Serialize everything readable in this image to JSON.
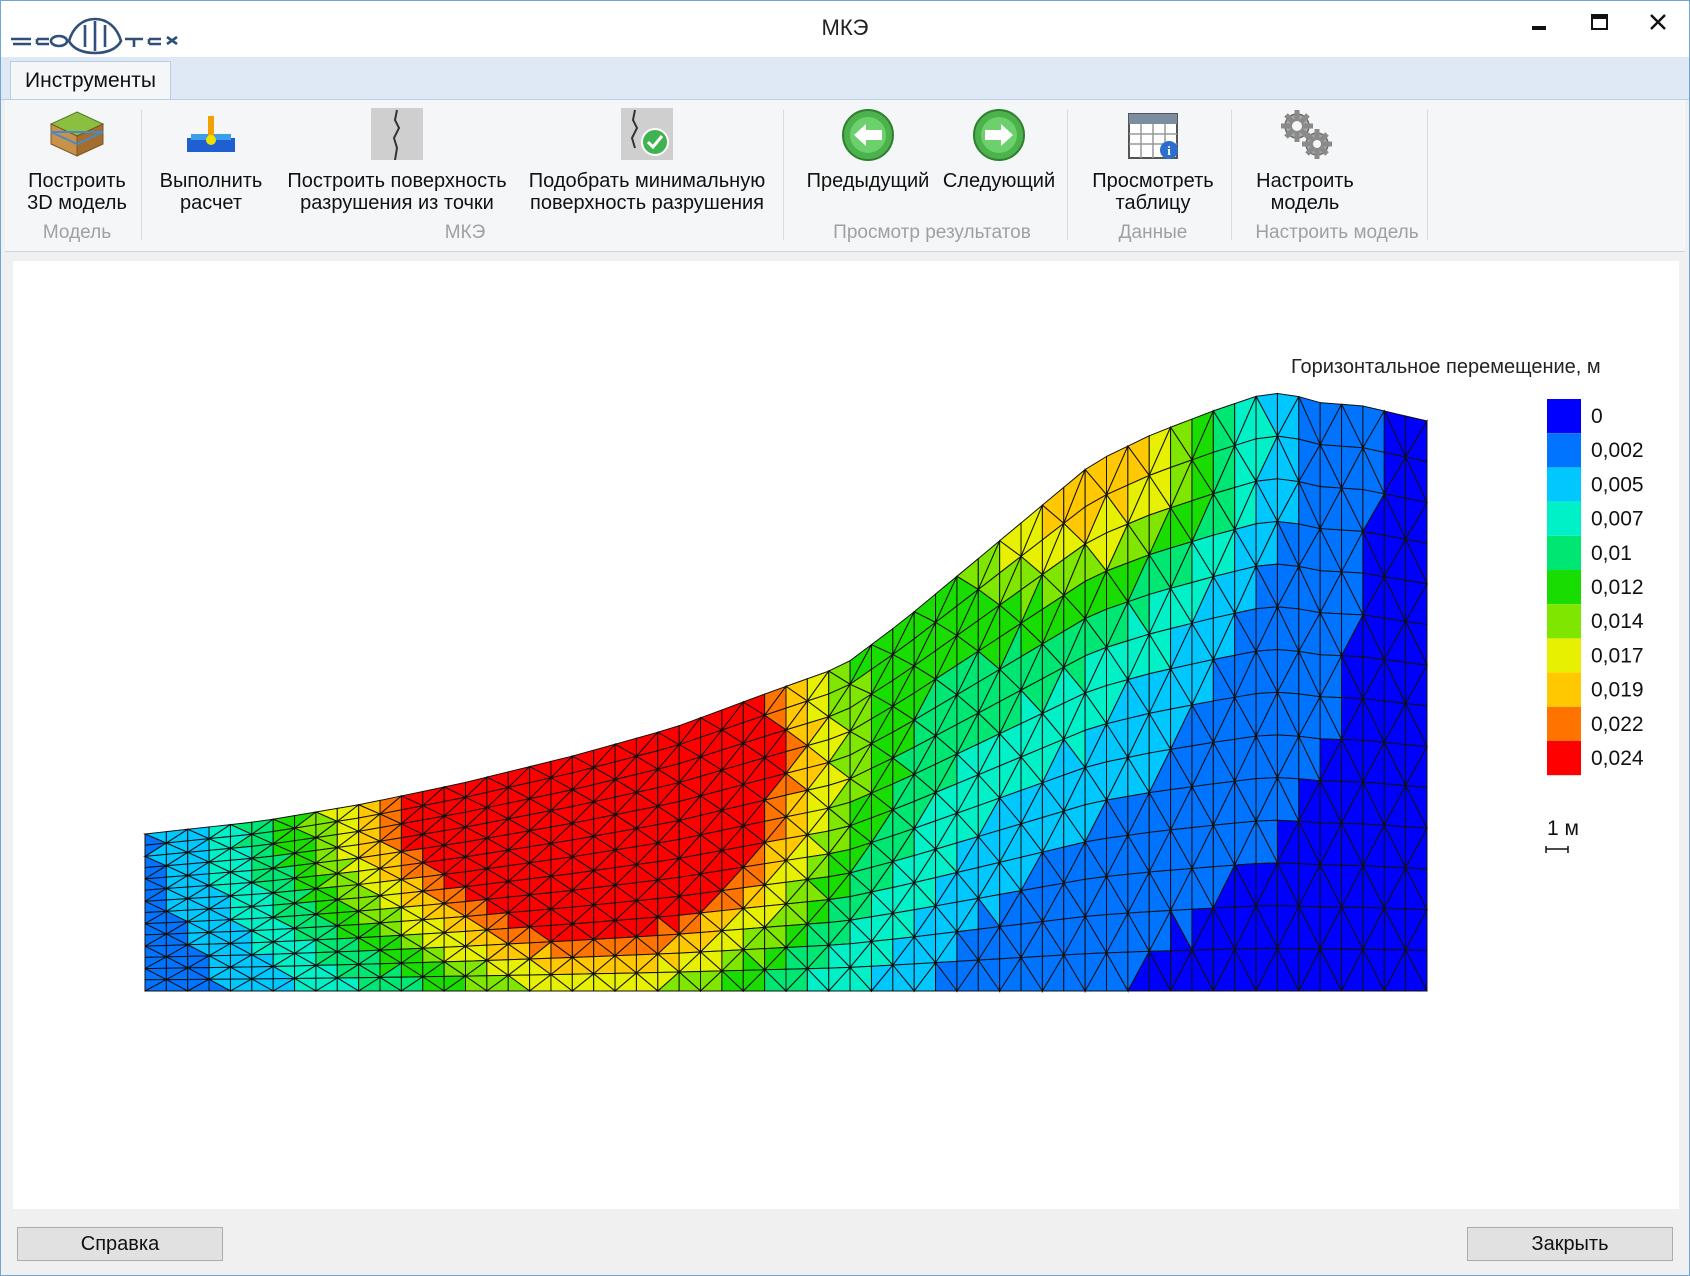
{
  "window": {
    "title": "МКЭ",
    "logo_text": "ГЕОТЕК"
  },
  "tabs": [
    {
      "label": "Инструменты"
    }
  ],
  "ribbon": {
    "buttons": [
      {
        "line1": "Построить",
        "line2": "3D модель",
        "icon": "3d-model-icon"
      },
      {
        "line1": "Выполнить",
        "line2": "расчет",
        "icon": "calculate-icon"
      },
      {
        "line1": "Построить поверхность",
        "line2": "разрушения из точки",
        "icon": "crack-surface-icon"
      },
      {
        "line1": "Подобрать минимальную",
        "line2": "поверхность разрушения",
        "icon": "crack-check-icon"
      },
      {
        "line1": "Предыдущий",
        "line2": "",
        "icon": "arrow-left-icon"
      },
      {
        "line1": "Следующий",
        "line2": "",
        "icon": "arrow-right-icon"
      },
      {
        "line1": "Просмотреть",
        "line2": "таблицу",
        "icon": "calendar-table-icon"
      },
      {
        "line1": "Настроить",
        "line2": "модель",
        "icon": "gears-icon"
      }
    ],
    "groups": [
      "Модель",
      "МКЭ",
      "Просмотр результатов",
      "Данные",
      "Настроить модель"
    ]
  },
  "legend": {
    "title": "Горизонтальное перемещение, м",
    "labels": [
      "0",
      "0,002",
      "0,005",
      "0,007",
      "0,01",
      "0,012",
      "0,014",
      "0,017",
      "0,019",
      "0,022",
      "0,024"
    ],
    "colors": [
      "#0000ff",
      "#0073ff",
      "#00c8ff",
      "#00f0c8",
      "#00e673",
      "#19dc00",
      "#7fe600",
      "#e6f000",
      "#ffc800",
      "#ff7300",
      "#ff0000"
    ],
    "scale_label": "1 м"
  },
  "bottom": {
    "help": "Справка",
    "close": "Закрыть"
  }
}
